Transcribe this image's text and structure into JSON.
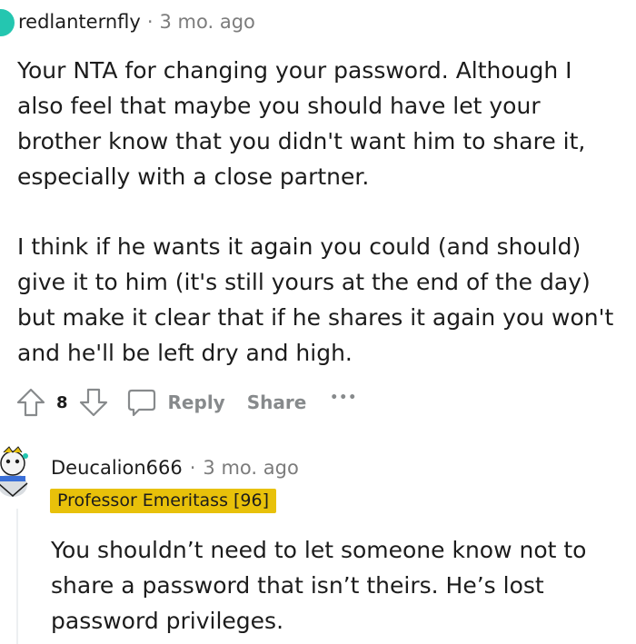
{
  "comment1": {
    "username": "redlanternfly",
    "separator": "·",
    "time": "3 mo. ago",
    "paragraphs": [
      "Your NTA for changing your password. Although I also feel that maybe you should have let your brother know that you didn't want him to share it, especially with a close partner.",
      "I think if he wants it again you could (and should) give it to him (it's still yours at the end of the day) but make it clear that if he shares it again you won't and he'll be left dry and high."
    ],
    "votes": "8",
    "reply_label": "Reply",
    "share_label": "Share",
    "more_label": "•••"
  },
  "comment2": {
    "username": "Deucalion666",
    "separator": "·",
    "time": "3 mo. ago",
    "flair": "Professor Emeritass [96]",
    "paragraphs": [
      "You shouldn’t need to let someone know not to share a password that isn’t theirs. He’s lost password privileges."
    ]
  },
  "colors": {
    "avatar1": "#24c6b0",
    "flair_bg": "#e8c10a",
    "meta_text": "#7c7c7c",
    "action_text": "#878a8c"
  }
}
